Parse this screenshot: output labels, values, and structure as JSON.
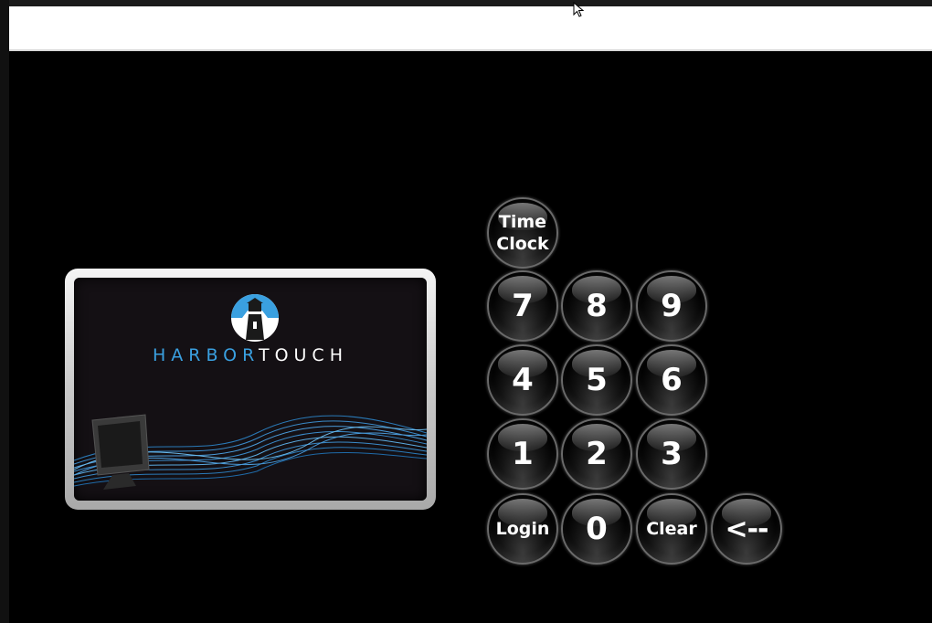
{
  "brand": {
    "part1": "HARBOR",
    "part2": "TOUCH",
    "accent_color": "#3aa0e0"
  },
  "keypad": {
    "time_clock_line1": "Time",
    "time_clock_line2": "Clock",
    "digits": {
      "k7": "7",
      "k8": "8",
      "k9": "9",
      "k4": "4",
      "k5": "5",
      "k6": "6",
      "k1": "1",
      "k2": "2",
      "k3": "3",
      "k0": "0"
    },
    "login": "Login",
    "clear": "Clear",
    "backspace": "<--"
  },
  "icons": {
    "cursor": "mouse-pointer-icon",
    "logo": "lighthouse-icon",
    "decoration": "pos-terminal-icon"
  }
}
